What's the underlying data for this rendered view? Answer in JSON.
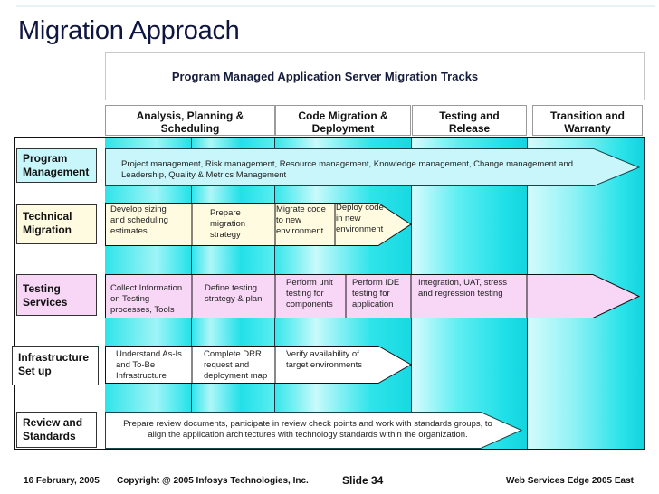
{
  "title": "Migration Approach",
  "subtitle": "Program Managed Application Server Migration Tracks",
  "colors": {
    "title": "#0d1540",
    "band_cyan": "#22e6ec",
    "program_fill": "#c8f6fa",
    "technical_fill": "#fffbe0",
    "testing_fill": "#f8d6f6",
    "white_fill": "#ffffff"
  },
  "phases": [
    {
      "label_line1": "Analysis, Planning &",
      "label_line2": "Scheduling"
    },
    {
      "label_line1": "Code Migration &",
      "label_line2": "Deployment"
    },
    {
      "label_line1": "Testing and",
      "label_line2": "Release"
    },
    {
      "label_line1": "Transition and",
      "label_line2": "Warranty"
    }
  ],
  "lanes": {
    "program": {
      "label_line1": "Program",
      "label_line2": "Management",
      "text_line1": "Project management, Risk management, Resource management, Knowledge management, Change management and",
      "text_line2": "Leadership, Quality & Metrics Management"
    },
    "technical": {
      "label_line1": "Technical",
      "label_line2": "Migration",
      "steps": [
        {
          "l1": "Develop sizing",
          "l2": "and scheduling",
          "l3": "estimates"
        },
        {
          "l1": "Prepare",
          "l2": "migration",
          "l3": "strategy"
        },
        {
          "l1": "Migrate code",
          "l2": "to new",
          "l3": "environment"
        },
        {
          "l1": "Deploy code",
          "l2": "in new",
          "l3": "environment"
        }
      ]
    },
    "testing": {
      "label_line1": "Testing",
      "label_line2": "Services",
      "steps": [
        {
          "l1": "Collect Information",
          "l2": "on Testing",
          "l3": "processes, Tools"
        },
        {
          "l1": "Define testing",
          "l2": "strategy & plan",
          "l3": ""
        },
        {
          "l1": "Perform unit",
          "l2": "testing for",
          "l3": "components"
        },
        {
          "l1": "Perform IDE",
          "l2": "testing for",
          "l3": "application"
        },
        {
          "l1": "Integration, UAT, stress",
          "l2": "and regression testing",
          "l3": ""
        }
      ]
    },
    "infrastructure": {
      "label_line1": "Infrastructure",
      "label_line2": "Set up",
      "steps": [
        {
          "l1": "Understand As-Is",
          "l2": "and To-Be",
          "l3": "Infrastructure"
        },
        {
          "l1": "Complete DRR",
          "l2": "request and",
          "l3": "deployment map"
        },
        {
          "l1": "Verify availability of",
          "l2": "target environments",
          "l3": ""
        }
      ]
    },
    "review": {
      "label_line1": "Review and",
      "label_line2": "Standards",
      "text_line1": "Prepare review documents, participate in review check points and work with standards groups, to",
      "text_line2": "align the application architectures with technology standards within the organization."
    }
  },
  "footer": {
    "date": "16 February, 2005",
    "copyright": "Copyright @ 2005 Infosys Technologies, Inc.",
    "slide": "Slide 34",
    "event": "Web Services Edge 2005 East"
  }
}
